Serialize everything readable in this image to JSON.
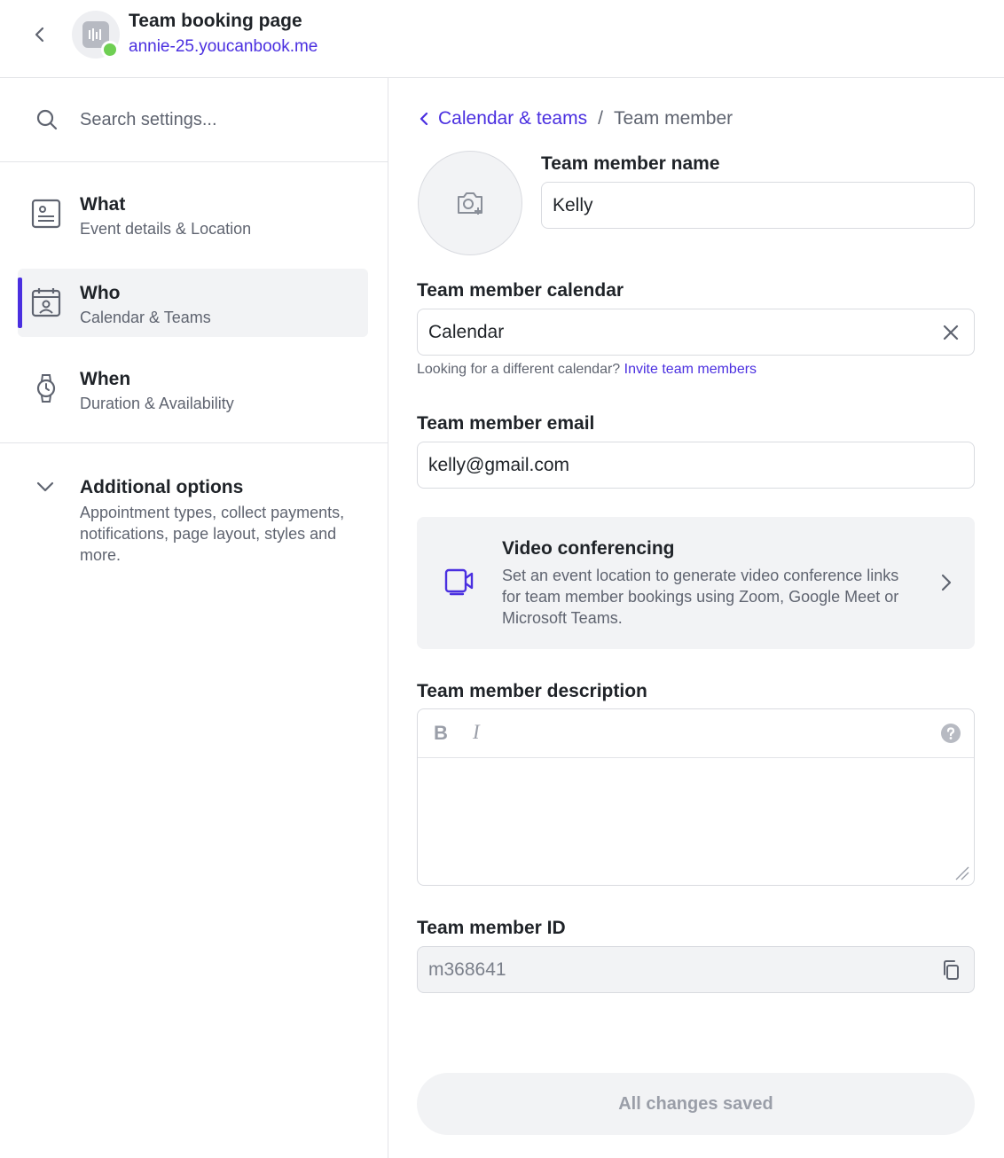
{
  "header": {
    "title": "Team booking page",
    "url": "annie-25.youcanbook.me"
  },
  "sidebar": {
    "search_placeholder": "Search settings...",
    "items": [
      {
        "title": "What",
        "subtitle": "Event details & Location",
        "icon": "document-icon"
      },
      {
        "title": "Who",
        "subtitle": "Calendar & Teams",
        "icon": "calendar-person-icon",
        "active": true
      },
      {
        "title": "When",
        "subtitle": "Duration & Availability",
        "icon": "watch-icon"
      }
    ],
    "additional": {
      "title": "Additional options",
      "subtitle": "Appointment types, collect payments, notifications, page layout, styles and more."
    }
  },
  "main": {
    "breadcrumb": {
      "parent": "Calendar & teams",
      "separator": "/",
      "current": "Team member"
    },
    "name_label": "Team member name",
    "name_value": "Kelly",
    "calendar_label": "Team member calendar",
    "calendar_value": "Calendar",
    "calendar_helper": "Looking for a different calendar?",
    "calendar_helper_link": "Invite team members",
    "email_label": "Team member email",
    "email_value": "kelly@gmail.com",
    "video": {
      "title": "Video conferencing",
      "description": "Set an event location to generate video conference links for team member bookings using Zoom, Google Meet or Microsoft Teams."
    },
    "description_label": "Team member description",
    "editor": {
      "bold": "B",
      "italic": "I"
    },
    "id_label": "Team member ID",
    "id_value": "m368641",
    "save_label": "All changes saved"
  },
  "colors": {
    "accent": "#4a2fe0",
    "online": "#6fcf53"
  }
}
